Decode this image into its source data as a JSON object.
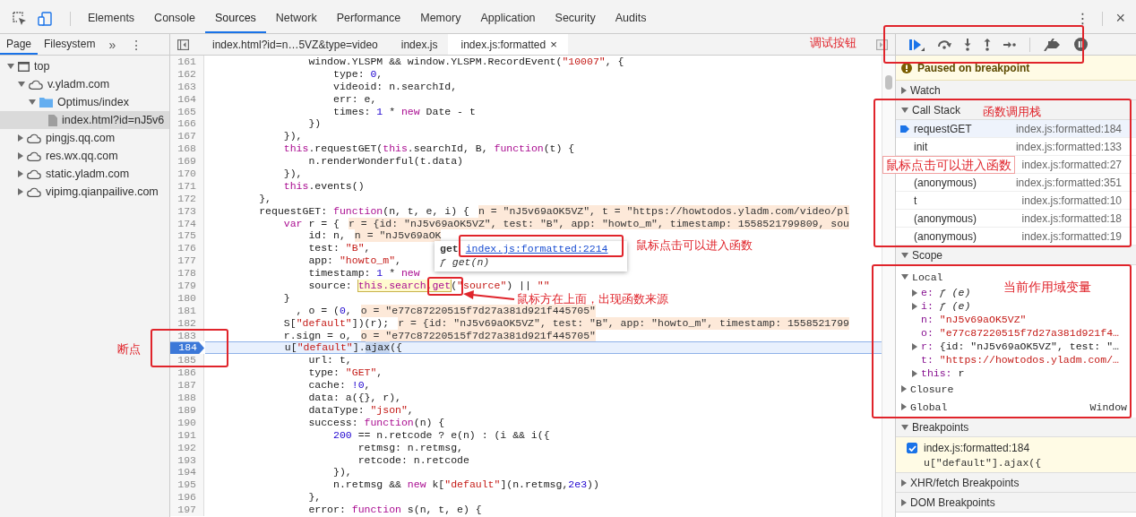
{
  "main_tabs": [
    {
      "label": "Elements",
      "selected": false
    },
    {
      "label": "Console",
      "selected": false
    },
    {
      "label": "Sources",
      "selected": true
    },
    {
      "label": "Network",
      "selected": false
    },
    {
      "label": "Performance",
      "selected": false
    },
    {
      "label": "Memory",
      "selected": false
    },
    {
      "label": "Application",
      "selected": false
    },
    {
      "label": "Security",
      "selected": false
    },
    {
      "label": "Audits",
      "selected": false
    }
  ],
  "top_menu": "⋮",
  "top_close": "×",
  "sidebar": {
    "tabs": [
      {
        "label": "Page",
        "selected": true
      },
      {
        "label": "Filesystem",
        "selected": false
      }
    ],
    "more": "»",
    "menu": "⋮",
    "tree": [
      {
        "label": "top",
        "kind": "frame",
        "expanded": true,
        "selected": false,
        "children": [
          {
            "label": "v.yladm.com",
            "kind": "domain",
            "expanded": true,
            "selected": false,
            "children": [
              {
                "label": "Optimus/index",
                "kind": "folder",
                "expanded": true,
                "selected": false,
                "children": [
                  {
                    "label": "index.html?id=nJ5v6",
                    "kind": "file",
                    "selected": true
                  }
                ]
              }
            ]
          },
          {
            "label": "pingjs.qq.com",
            "kind": "domain",
            "expanded": false,
            "selected": false
          },
          {
            "label": "res.wx.qq.com",
            "kind": "domain",
            "expanded": false,
            "selected": false
          },
          {
            "label": "static.yladm.com",
            "kind": "domain",
            "expanded": false,
            "selected": false
          },
          {
            "label": "vipimg.qianpailive.com",
            "kind": "domain",
            "expanded": false,
            "selected": false
          }
        ]
      }
    ]
  },
  "editor": {
    "tabs": [
      {
        "label": "index.html?id=n…5VZ&type=video",
        "selected": false
      },
      {
        "label": "index.js",
        "selected": false
      },
      {
        "label": "index.js:formatted",
        "selected": true,
        "close": "×"
      }
    ],
    "lines": [
      {
        "number": "161",
        "breakpoint": false,
        "paused": false,
        "tokens": [
          {
            "kind": "plain",
            "text": "                window.YLSPM && window.YLSPM.RecordEvent("
          },
          {
            "kind": "string",
            "text": "\"10007\""
          },
          {
            "kind": "plain",
            "text": ", {"
          }
        ]
      },
      {
        "number": "162",
        "breakpoint": false,
        "paused": false,
        "tokens": [
          {
            "kind": "plain",
            "text": "                    type: "
          },
          {
            "kind": "number",
            "text": "0"
          },
          {
            "kind": "plain",
            "text": ","
          }
        ]
      },
      {
        "number": "163",
        "breakpoint": false,
        "paused": false,
        "tokens": [
          {
            "kind": "plain",
            "text": "                    videoid: n.searchId,"
          }
        ]
      },
      {
        "number": "164",
        "breakpoint": false,
        "paused": false,
        "tokens": [
          {
            "kind": "plain",
            "text": "                    err: e,"
          }
        ]
      },
      {
        "number": "165",
        "breakpoint": false,
        "paused": false,
        "tokens": [
          {
            "kind": "plain",
            "text": "                    times: "
          },
          {
            "kind": "number",
            "text": "1"
          },
          {
            "kind": "plain",
            "text": " * "
          },
          {
            "kind": "keyword",
            "text": "new"
          },
          {
            "kind": "plain",
            "text": " Date - t"
          }
        ]
      },
      {
        "number": "166",
        "breakpoint": false,
        "paused": false,
        "tokens": [
          {
            "kind": "plain",
            "text": "                })"
          }
        ]
      },
      {
        "number": "167",
        "breakpoint": false,
        "paused": false,
        "tokens": [
          {
            "kind": "plain",
            "text": "            }),"
          }
        ]
      },
      {
        "number": "168",
        "breakpoint": false,
        "paused": false,
        "tokens": [
          {
            "kind": "keyword",
            "text": "            this"
          },
          {
            "kind": "plain",
            "text": ".requestGET("
          },
          {
            "kind": "keyword",
            "text": "this"
          },
          {
            "kind": "plain",
            "text": ".searchId, B, "
          },
          {
            "kind": "keyword",
            "text": "function"
          },
          {
            "kind": "plain",
            "text": "(t) {"
          }
        ]
      },
      {
        "number": "169",
        "breakpoint": false,
        "paused": false,
        "tokens": [
          {
            "kind": "plain",
            "text": "                n.renderWonderful(t.data)"
          }
        ]
      },
      {
        "number": "170",
        "breakpoint": false,
        "paused": false,
        "tokens": [
          {
            "kind": "plain",
            "text": "            }),"
          }
        ]
      },
      {
        "number": "171",
        "breakpoint": false,
        "paused": false,
        "tokens": [
          {
            "kind": "keyword",
            "text": "            this"
          },
          {
            "kind": "plain",
            "text": ".events()"
          }
        ]
      },
      {
        "number": "172",
        "breakpoint": false,
        "paused": false,
        "tokens": [
          {
            "kind": "plain",
            "text": "        },"
          }
        ]
      },
      {
        "number": "173",
        "breakpoint": false,
        "paused": false,
        "tokens": [
          {
            "kind": "plain",
            "text": "        requestGET: "
          },
          {
            "kind": "keyword",
            "text": "function"
          },
          {
            "kind": "plain",
            "text": "(n, t, e, i) {"
          }
        ],
        "inline_value": "n = \"nJ5v69aOK5VZ\", t = \"https://howtodos.yladm.com/video/pl"
      },
      {
        "number": "174",
        "breakpoint": false,
        "paused": false,
        "tokens": [
          {
            "kind": "keyword",
            "text": "            var"
          },
          {
            "kind": "plain",
            "text": " r = {"
          }
        ],
        "inline_value": "r = {id: \"nJ5v69aOK5VZ\", test: \"B\", app: \"howto_m\", timestamp: 1558521799809, sou"
      },
      {
        "number": "175",
        "breakpoint": false,
        "paused": false,
        "tokens": [
          {
            "kind": "plain",
            "text": "                id: n,"
          }
        ],
        "inline_value": "n = \"nJ5v69aOK"
      },
      {
        "number": "176",
        "breakpoint": false,
        "paused": false,
        "tokens": [
          {
            "kind": "plain",
            "text": "                test: "
          },
          {
            "kind": "string",
            "text": "\"B\""
          },
          {
            "kind": "plain",
            "text": ","
          }
        ]
      },
      {
        "number": "177",
        "breakpoint": false,
        "paused": false,
        "tokens": [
          {
            "kind": "plain",
            "text": "                app: "
          },
          {
            "kind": "string",
            "text": "\"howto_m\""
          },
          {
            "kind": "plain",
            "text": ","
          }
        ]
      },
      {
        "number": "178",
        "breakpoint": false,
        "paused": false,
        "tokens": [
          {
            "kind": "plain",
            "text": "                timestamp: "
          },
          {
            "kind": "number",
            "text": "1"
          },
          {
            "kind": "plain",
            "text": " * "
          },
          {
            "kind": "keyword",
            "text": "new"
          }
        ]
      },
      {
        "number": "179",
        "breakpoint": false,
        "paused": false,
        "tokens": [
          {
            "kind": "plain",
            "text": "                source: "
          },
          {
            "kind": "hover",
            "text": "this.search.get"
          },
          {
            "kind": "plain",
            "text": "("
          },
          {
            "kind": "string",
            "text": "\"source\""
          },
          {
            "kind": "plain",
            "text": ") || "
          },
          {
            "kind": "string",
            "text": "\"\""
          }
        ]
      },
      {
        "number": "180",
        "breakpoint": false,
        "paused": false,
        "tokens": [
          {
            "kind": "plain",
            "text": "            }"
          }
        ]
      },
      {
        "number": "181",
        "breakpoint": false,
        "paused": false,
        "tokens": [
          {
            "kind": "plain",
            "text": "              , o = ("
          },
          {
            "kind": "number",
            "text": "0"
          },
          {
            "kind": "plain",
            "text": ","
          }
        ],
        "inline_value": "o = \"e77c87220515f7d27a381d921f445705\""
      },
      {
        "number": "182",
        "breakpoint": false,
        "paused": false,
        "tokens": [
          {
            "kind": "plain",
            "text": "            S["
          },
          {
            "kind": "string",
            "text": "\"default\""
          },
          {
            "kind": "plain",
            "text": "])(r);"
          }
        ],
        "inline_value": "r = {id: \"nJ5v69aOK5VZ\", test: \"B\", app: \"howto_m\", timestamp: 1558521799"
      },
      {
        "number": "183",
        "breakpoint": false,
        "paused": false,
        "tokens": [
          {
            "kind": "plain",
            "text": "            r.sign = o,"
          }
        ],
        "inline_value": "o = \"e77c87220515f7d27a381d921f445705\""
      },
      {
        "number": "184",
        "breakpoint": true,
        "paused": true,
        "tokens": [
          {
            "kind": "plain",
            "text": "            u["
          },
          {
            "kind": "string",
            "text": "\"default\""
          },
          {
            "kind": "plain",
            "text": "]."
          },
          {
            "kind": "selection",
            "text": "ajax"
          },
          {
            "kind": "plain",
            "text": "({"
          }
        ]
      },
      {
        "number": "185",
        "breakpoint": false,
        "paused": false,
        "tokens": [
          {
            "kind": "plain",
            "text": "                url: t,"
          }
        ]
      },
      {
        "number": "186",
        "breakpoint": false,
        "paused": false,
        "tokens": [
          {
            "kind": "plain",
            "text": "                type: "
          },
          {
            "kind": "string",
            "text": "\"GET\""
          },
          {
            "kind": "plain",
            "text": ","
          }
        ]
      },
      {
        "number": "187",
        "breakpoint": false,
        "paused": false,
        "tokens": [
          {
            "kind": "plain",
            "text": "                cache: "
          },
          {
            "kind": "number",
            "text": "!0"
          },
          {
            "kind": "plain",
            "text": ","
          }
        ]
      },
      {
        "number": "188",
        "breakpoint": false,
        "paused": false,
        "tokens": [
          {
            "kind": "plain",
            "text": "                data: a({}, r),"
          }
        ]
      },
      {
        "number": "189",
        "breakpoint": false,
        "paused": false,
        "tokens": [
          {
            "kind": "plain",
            "text": "                dataType: "
          },
          {
            "kind": "string",
            "text": "\"json\""
          },
          {
            "kind": "plain",
            "text": ","
          }
        ]
      },
      {
        "number": "190",
        "breakpoint": false,
        "paused": false,
        "tokens": [
          {
            "kind": "plain",
            "text": "                success: "
          },
          {
            "kind": "keyword",
            "text": "function"
          },
          {
            "kind": "plain",
            "text": "(n) {"
          }
        ]
      },
      {
        "number": "191",
        "breakpoint": false,
        "paused": false,
        "tokens": [
          {
            "kind": "number",
            "text": "                    200"
          },
          {
            "kind": "plain",
            "text": " == n.retcode ? e(n) : (i && i({"
          }
        ]
      },
      {
        "number": "192",
        "breakpoint": false,
        "paused": false,
        "tokens": [
          {
            "kind": "plain",
            "text": "                        retmsg: n.retmsg,"
          }
        ]
      },
      {
        "number": "193",
        "breakpoint": false,
        "paused": false,
        "tokens": [
          {
            "kind": "plain",
            "text": "                        retcode: n.retcode"
          }
        ]
      },
      {
        "number": "194",
        "breakpoint": false,
        "paused": false,
        "tokens": [
          {
            "kind": "plain",
            "text": "                    }),"
          }
        ]
      },
      {
        "number": "195",
        "breakpoint": false,
        "paused": false,
        "tokens": [
          {
            "kind": "plain",
            "text": "                    n.retmsg && "
          },
          {
            "kind": "keyword",
            "text": "new"
          },
          {
            "kind": "plain",
            "text": " k["
          },
          {
            "kind": "string",
            "text": "\"default\""
          },
          {
            "kind": "plain",
            "text": "](n.retmsg,"
          },
          {
            "kind": "number",
            "text": "2e3"
          },
          {
            "kind": "plain",
            "text": "))"
          }
        ]
      },
      {
        "number": "196",
        "breakpoint": false,
        "paused": false,
        "tokens": [
          {
            "kind": "plain",
            "text": "                },"
          }
        ]
      },
      {
        "number": "197",
        "breakpoint": false,
        "paused": false,
        "tokens": [
          {
            "kind": "plain",
            "text": "                error: "
          },
          {
            "kind": "keyword",
            "text": "function"
          },
          {
            "kind": "plain",
            "text": " s(n, t, e) {"
          }
        ]
      }
    ],
    "tooltip": {
      "title": "get",
      "link": "index.js:formatted:2214",
      "signature": "ƒ get(n)"
    }
  },
  "debugger": {
    "buttons": [
      {
        "kind": "resume"
      },
      {
        "kind": "step-over"
      },
      {
        "kind": "step-into"
      },
      {
        "kind": "step-out"
      },
      {
        "kind": "step"
      },
      {
        "kind": "deactivate"
      },
      {
        "kind": "pause-exceptions"
      }
    ],
    "status": "Paused on breakpoint",
    "watch": {
      "title": "Watch",
      "expanded": false
    },
    "call_stack": {
      "title": "Call Stack",
      "expanded": true,
      "frames": [
        {
          "function": "requestGET",
          "location": "index.js:formatted:184",
          "selected": true
        },
        {
          "function": "init",
          "location": "index.js:formatted:133",
          "selected": false
        },
        {
          "location": "index.js:formatted:27",
          "selected": false
        },
        {
          "function": "(anonymous)",
          "location": "index.js:formatted:351",
          "selected": false
        },
        {
          "function": "t",
          "location": "index.js:formatted:10",
          "selected": false
        },
        {
          "function": "(anonymous)",
          "location": "index.js:formatted:18",
          "selected": false
        },
        {
          "function": "(anonymous)",
          "location": "index.js:formatted:19",
          "selected": false
        }
      ]
    },
    "scope": {
      "title": "Scope",
      "expanded": true,
      "groups": [
        {
          "title": "Local",
          "expanded": true,
          "variables": [
            {
              "name": "e:",
              "value": "ƒ (e)",
              "kind": "function",
              "expanded": false
            },
            {
              "name": "i:",
              "value": "ƒ (e)",
              "kind": "function",
              "expanded": false
            },
            {
              "name": "n:",
              "value": "\"nJ5v69aOK5VZ\"",
              "kind": "string"
            },
            {
              "name": "o:",
              "value": "\"e77c87220515f7d27a381d921f4…",
              "kind": "string"
            },
            {
              "name": "r:",
              "value": "{id: \"nJ5v69aOK5VZ\", test: \"…",
              "kind": "object",
              "expanded": false
            },
            {
              "name": "t:",
              "value": "\"https://howtodos.yladm.com/…",
              "kind": "string"
            },
            {
              "name": "this:",
              "value": "r",
              "kind": "object",
              "expanded": false
            }
          ]
        },
        {
          "title": "Closure",
          "expanded": false
        },
        {
          "title": "Global",
          "expanded": false,
          "value": "Window"
        }
      ]
    },
    "breakpoints": {
      "title": "Breakpoints",
      "expanded": true,
      "items": [
        {
          "location": "index.js:formatted:184",
          "code": "u[\"default\"].ajax({",
          "checked": true
        }
      ]
    },
    "xhr_breakpoints": {
      "title": "XHR/fetch Breakpoints",
      "expanded": false
    },
    "dom_breakpoints": {
      "title": "DOM Breakpoints",
      "expanded": false
    }
  },
  "annotations": [
    {
      "kind": "toolbar",
      "text": "调试按钮"
    },
    {
      "kind": "callstack",
      "text": "函数调用栈"
    },
    {
      "kind": "frame",
      "text": "鼠标点击可以进入函数"
    },
    {
      "kind": "tooltip",
      "text": "鼠标点击可以进入函数"
    },
    {
      "kind": "hover",
      "text": "鼠标方在上面，出现函数来源"
    },
    {
      "kind": "breakpoint",
      "text": "断点"
    },
    {
      "kind": "scope",
      "text": "当前作用域变量"
    }
  ]
}
